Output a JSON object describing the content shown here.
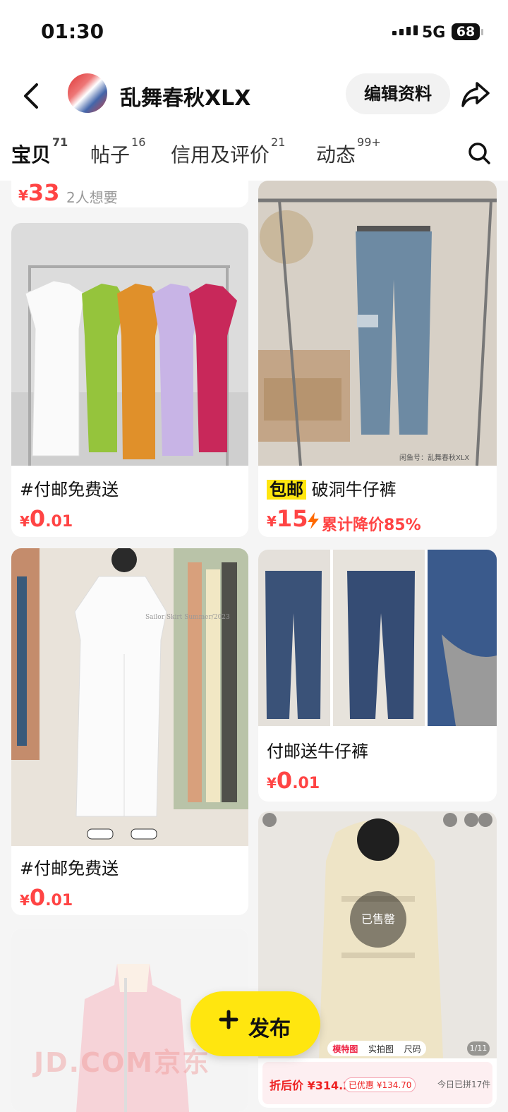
{
  "status": {
    "time": "01:30",
    "network": "5G",
    "battery": "68"
  },
  "profile": {
    "name": "乱舞春秋XLX",
    "edit_label": "编辑资料"
  },
  "tabs": [
    {
      "label": "宝贝",
      "count": "71"
    },
    {
      "label": "帖子",
      "count": "16"
    },
    {
      "label": "信用及评价",
      "count": "21"
    },
    {
      "label": "动态",
      "count": "99+"
    }
  ],
  "items": {
    "top_partial": {
      "yen": "¥",
      "price": "33",
      "want": "2人想要"
    },
    "dresses": {
      "title": "#付邮免费送",
      "yen": "¥",
      "price_int": "0",
      "price_dec": ".01"
    },
    "jeans": {
      "badge": "包邮",
      "title": "破洞牛仔裤",
      "yen": "¥",
      "price": "15",
      "drop": "累计降价85%",
      "img_caption": "闲鱼号：乱舞春秋XLX"
    },
    "white_dress": {
      "title": "#付邮免费送",
      "yen": "¥",
      "price_int": "0",
      "price_dec": ".01",
      "img_text": "Sailor Skirt Summer/2023"
    },
    "jeans2": {
      "title": "付邮送牛仔裤",
      "yen": "¥",
      "price_int": "0",
      "price_dec": ".01"
    },
    "coat": {
      "sold_label": "已售罄",
      "tags": [
        "模特图",
        "实拍图",
        "尺码"
      ],
      "page": "1/11",
      "after_price": "折后价 ¥314.29",
      "discount": "已优惠 ¥134.70",
      "group": "今日已拼17件"
    }
  },
  "publish_label": "发布",
  "watermark": "JD.COM京东",
  "colors": {
    "accent": "#ffe60f",
    "price": "#ff4444"
  }
}
